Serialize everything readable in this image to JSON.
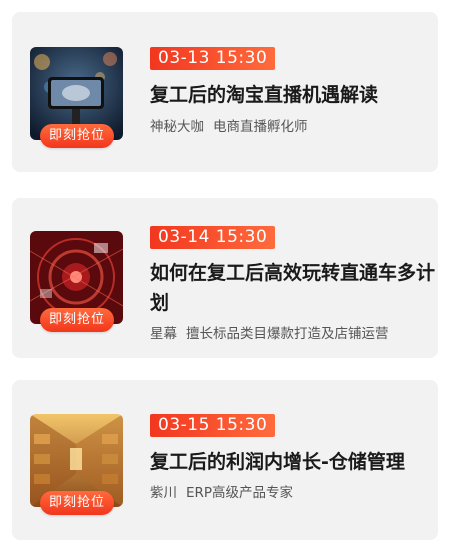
{
  "courses": [
    {
      "time": "03-13 15:30",
      "title": "复工后的淘宝直播机遇解读",
      "speaker": "神秘大咖",
      "role": "电商直播孵化师",
      "grab_label": "即刻抢位"
    },
    {
      "time": "03-14 15:30",
      "title": "如何在复工后高效玩转直通车多计划",
      "speaker": "星幕",
      "role": "擅长标品类目爆款打造及店铺运营",
      "grab_label": "即刻抢位"
    },
    {
      "time": "03-15 15:30",
      "title": "复工后的利润内增长-仓储管理",
      "speaker": "紫川",
      "role": "ERP高级产品专家",
      "grab_label": "即刻抢位"
    }
  ],
  "colors": {
    "accent": "#f2361c",
    "card_bg": "#f2f2f2"
  }
}
